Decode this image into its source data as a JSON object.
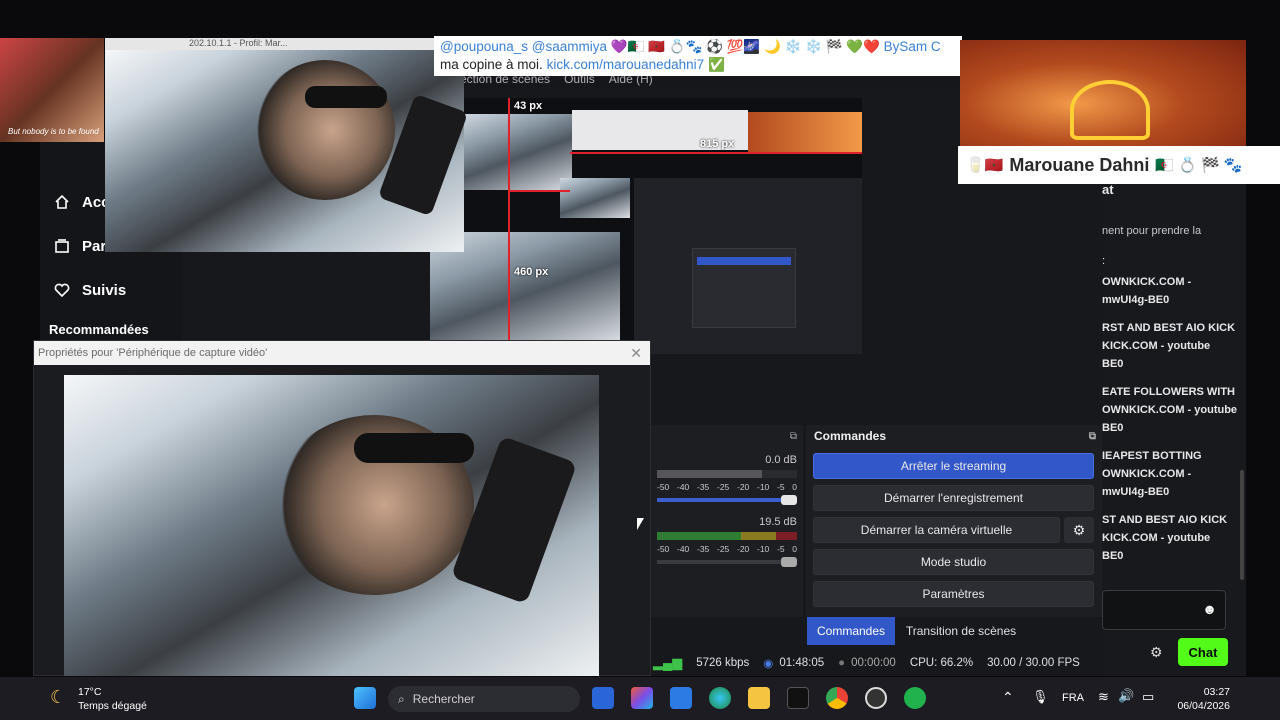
{
  "kick_sidebar": {
    "items": [
      {
        "label": "Acc",
        "icon": "home-icon"
      },
      {
        "label": "Par",
        "icon": "browse-icon"
      },
      {
        "label": "Suivis",
        "icon": "heart-icon"
      }
    ],
    "recommended_label": "Recommandées"
  },
  "obs": {
    "menu_items": [
      "ection de scènes",
      "Outils",
      "Aide (H)"
    ],
    "preview_measures": {
      "top": "43 px",
      "right": "815 px",
      "bottom": "460 px"
    },
    "properties_title": "Propriétés pour 'Périphérique de capture vidéo'",
    "mixer": {
      "channel1_db": "0.0 dB",
      "channel2_db": "19.5 dB",
      "scale": [
        "0",
        "-55",
        "-50",
        "-45",
        "-40",
        "-35",
        "-30",
        "-25",
        "-20",
        "-15",
        "-10",
        "-5",
        "0"
      ]
    },
    "commands": {
      "header": "Commandes",
      "stop_streaming": "Arrêter le streaming",
      "start_recording": "Démarrer l'enregistrement",
      "start_virtual_camera": "Démarrer la caméra virtuelle",
      "studio_mode": "Mode studio",
      "settings": "Paramètres"
    },
    "tabs": {
      "commands": "Commandes",
      "transition": "Transition de scènes"
    },
    "status": {
      "bitrate": "5726 kbps",
      "stream_time": "01:48:05",
      "record_time": "00:00:00",
      "cpu": "CPU: 66.2%",
      "fps": "30.00 / 30.00 FPS"
    }
  },
  "chat": {
    "header": "at",
    "intro": "nent pour prendre la",
    "colon": ":",
    "lines": [
      "OWNKICK.COM -",
      "mwUI4g-BE0",
      "RST AND BEST AIO KICK",
      "KICK.COM - youtube",
      "BE0",
      "EATE FOLLOWERS WITH",
      "OWNKICK.COM - youtube",
      "BE0",
      "IEAPEST BOTTING",
      "OWNKICK.COM -",
      "mwUI4g-BE0",
      "ST AND BEST AIO KICK",
      "KICK.COM - youtube",
      "BE0"
    ],
    "send_label": "Chat"
  },
  "overlays": {
    "tiny_caption": "But nobody is to be found",
    "twitter_line1": "@poupouna_s @saammiya 💜🇩🇿 🇲🇦 💍🐾 ⚽ 💯🌌 🌙 ❄️ ❄️ 🏁 💚❤️ BySam C",
    "twitter_line2_prefix": "ma copine à moi.",
    "twitter_link": "kick.com/marouanedahni7",
    "name_tag": "Marouane Dahni",
    "name_tag_emojis_left": "🥛🇲🇦",
    "name_tag_emojis_right": "🇩🇿 💍 🏁 🐾",
    "browser_tab_text": "202.10.1.1 - Profil: Mar..."
  },
  "taskbar": {
    "temperature": "17°C",
    "weather": "Temps dégagé",
    "search_placeholder": "Rechercher",
    "language": "FRA",
    "time": "03:27",
    "date": "06/04/2026"
  }
}
